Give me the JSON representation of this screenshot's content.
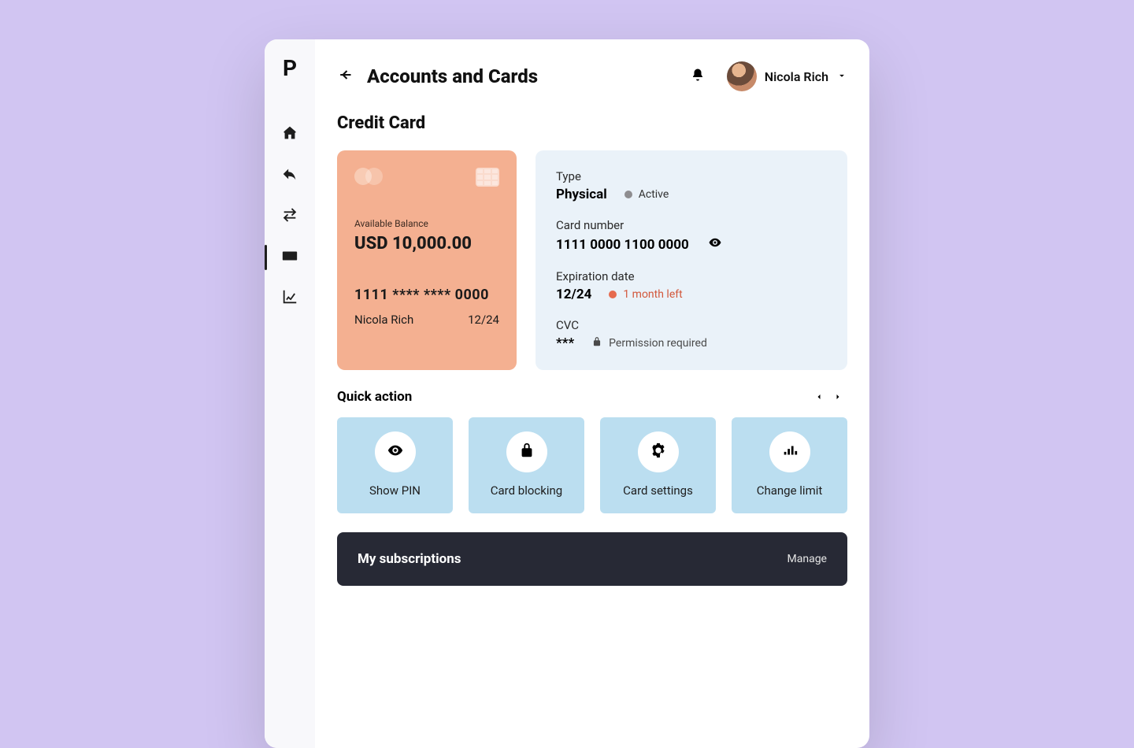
{
  "logo": "P",
  "header": {
    "title": "Accounts and Cards",
    "username": "Nicola Rich"
  },
  "section_title": "Credit Card",
  "card": {
    "available_balance_label": "Available Balance",
    "available_balance": "USD 10,000.00",
    "masked_number": "1111 **** **** 0000",
    "holder": "Nicola Rich",
    "expiry": "12/24"
  },
  "details": {
    "type_label": "Type",
    "type_value": "Physical",
    "type_status": "Active",
    "number_label": "Card number",
    "number_value": "1111 0000 1100 0000",
    "expiration_label": "Expiration date",
    "expiration_value": "12/24",
    "expiration_warning": "1 month left",
    "cvc_label": "CVC",
    "cvc_value": "***",
    "cvc_permission": "Permission required"
  },
  "quick": {
    "title": "Quick action",
    "items": [
      {
        "label": "Show PIN"
      },
      {
        "label": "Card blocking"
      },
      {
        "label": "Card settings"
      },
      {
        "label": "Change limit"
      }
    ]
  },
  "subscriptions": {
    "title": "My subscriptions",
    "manage": "Manage"
  }
}
